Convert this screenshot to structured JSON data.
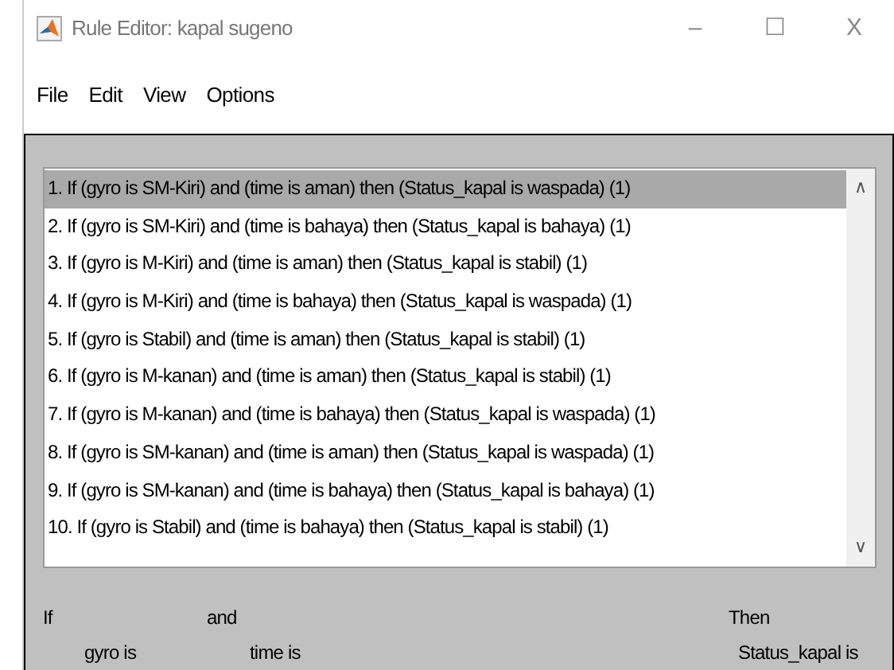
{
  "window": {
    "title": "Rule Editor: kapal sugeno",
    "controls": [
      "–",
      "☐",
      "X"
    ]
  },
  "menu": [
    "File",
    "Edit",
    "View",
    "Options"
  ],
  "rules": [
    {
      "text": "1. If (gyro is SM-Kiri) and (time is aman) then (Status_kapal is waspada) (1)",
      "selected": true
    },
    {
      "text": "2. If (gyro is SM-Kiri) and (time is bahaya) then (Status_kapal is bahaya) (1)",
      "selected": false
    },
    {
      "text": "3. If (gyro is M-Kiri) and (time is aman) then (Status_kapal is stabil) (1)",
      "selected": false
    },
    {
      "text": "4. If (gyro is M-Kiri) and (time is bahaya) then (Status_kapal is waspada) (1)",
      "selected": false
    },
    {
      "text": "5. If (gyro is Stabil) and (time is aman) then (Status_kapal is stabil) (1)",
      "selected": false
    },
    {
      "text": "6. If (gyro is M-kanan) and (time is aman) then (Status_kapal is stabil) (1)",
      "selected": false
    },
    {
      "text": "7. If (gyro is M-kanan) and (time is bahaya) then (Status_kapal is waspada) (1)",
      "selected": false
    },
    {
      "text": "8. If (gyro is SM-kanan) and (time is aman) then (Status_kapal is waspada) (1)",
      "selected": false
    },
    {
      "text": "9. If (gyro is SM-kanan) and (time is bahaya) then (Status_kapal is bahaya) (1)",
      "selected": false
    },
    {
      "text": "10. If (gyro is Stabil) and (time is bahaya) then (Status_kapal is stabil) (1)",
      "selected": false
    }
  ],
  "scrollbar": {
    "up": "∧",
    "down": "∨"
  },
  "editor": {
    "if_label": "If",
    "and_label": "and",
    "then_label": "Then",
    "inputs": [
      "gyro is",
      "time is"
    ],
    "output": "Status_kapal is"
  }
}
